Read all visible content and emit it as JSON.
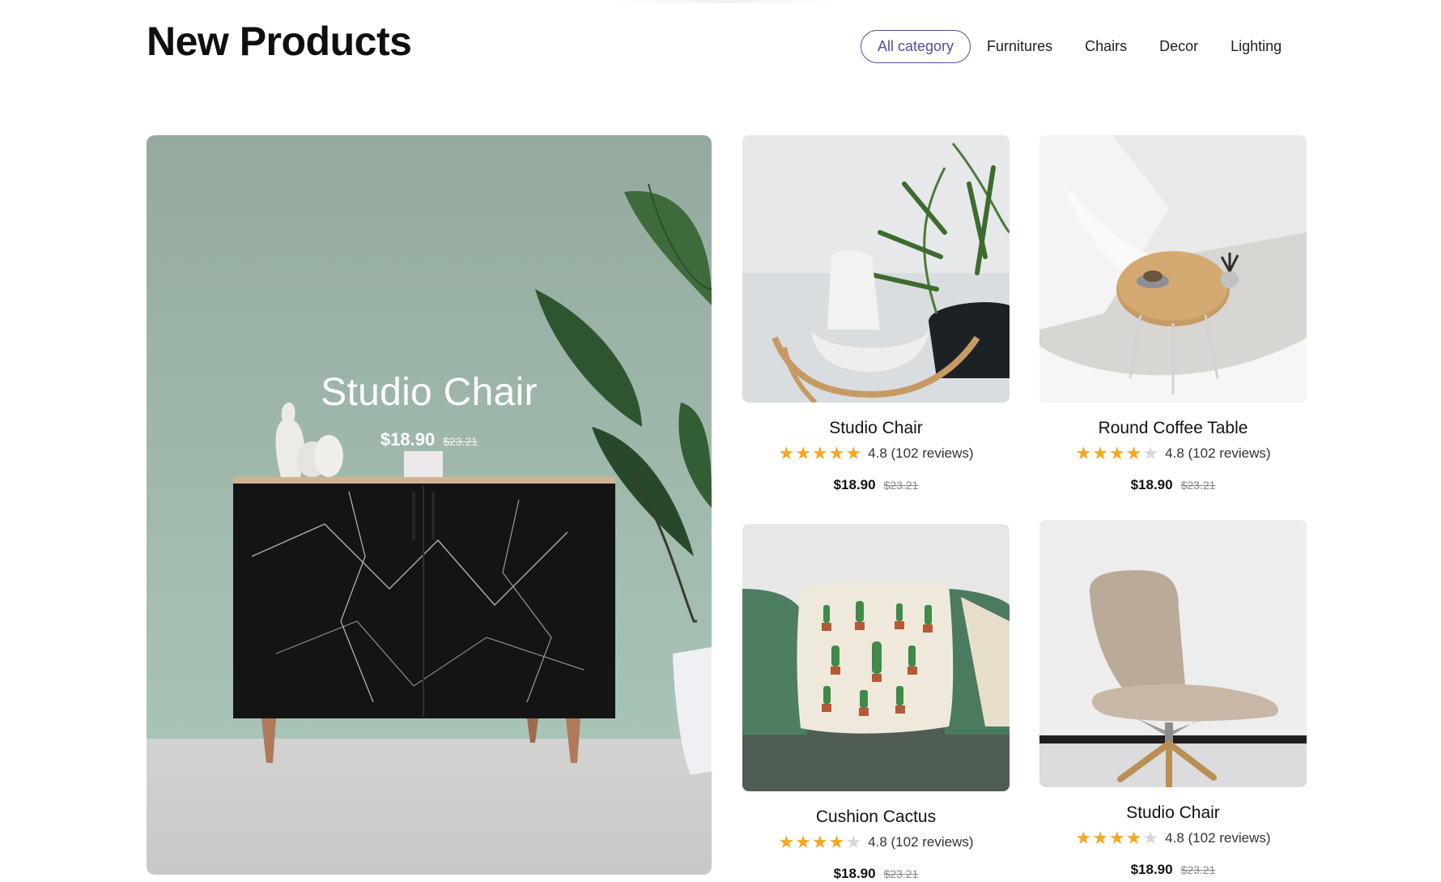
{
  "header": {
    "title": "New Products"
  },
  "categories": [
    {
      "label": "All category",
      "active": true
    },
    {
      "label": "Furnitures",
      "active": false
    },
    {
      "label": "Chairs",
      "active": false
    },
    {
      "label": "Decor",
      "active": false
    },
    {
      "label": "Lighting",
      "active": false
    }
  ],
  "featured": {
    "name": "Studio Chair",
    "price": "$18.90",
    "old_price": "$23.21"
  },
  "products": [
    {
      "name": "Studio Chair",
      "rating": 4.8,
      "rating_text": "4.8 (102 reviews)",
      "stars_filled": 5,
      "price": "$18.90",
      "old_price": "$23.21"
    },
    {
      "name": "Round Coffee Table",
      "rating": 4.8,
      "rating_text": "4.8 (102 reviews)",
      "stars_filled": 4,
      "price": "$18.90",
      "old_price": "$23.21"
    },
    {
      "name": "Cushion Cactus",
      "rating": 4.8,
      "rating_text": "4.8 (102 reviews)",
      "stars_filled": 4,
      "price": "$18.90",
      "old_price": "$23.21"
    },
    {
      "name": "Studio Chair",
      "rating": 4.8,
      "rating_text": "4.8 (102 reviews)",
      "stars_filled": 4,
      "price": "$18.90",
      "old_price": "$23.21"
    }
  ],
  "colors": {
    "accent": "#5a4a9a",
    "star": "#f5a623",
    "star_off": "#d7d7d7",
    "featured_bg": "#9fb5ab"
  }
}
